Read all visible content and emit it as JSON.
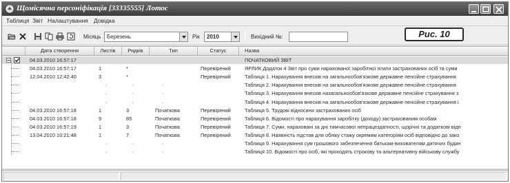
{
  "window": {
    "title": "Щомісячна персоніфікація [33335555] Лотос"
  },
  "menu": [
    "Таблиця",
    "Звіт",
    "Налаштування",
    "Довідка"
  ],
  "toolbar": {
    "month_label": "Місяць",
    "month_value": "Березень",
    "year_label": "Рік",
    "year_value": "2010",
    "outgoing_label": "Вихідний №:",
    "outgoing_value": ""
  },
  "figure_label": "Рис. 10",
  "columns": [
    "Дата створення",
    "Листів",
    "Рядків",
    "Тип",
    "Статус",
    "Назва"
  ],
  "rows": [
    {
      "date": "04.03.2010 16:57:17",
      "sheets": "",
      "lines": "",
      "type": "",
      "status": "",
      "name": "ПОЧАТКОВИЙ ЗВІТ",
      "checked": true,
      "root": true
    },
    {
      "date": "04.03.2010 16:57:17",
      "sheets": "1",
      "lines": "*",
      "type": "",
      "status": "Перевірений",
      "name": "ЯРЛИК Додаток 4 Звіт про суми нарахованої заробітної плати застрахованих осіб та суми"
    },
    {
      "date": "12.04.2010 12:42:40",
      "sheets": "3",
      "lines": "*",
      "type": "",
      "status": "Перевірений",
      "name": "Таблиця 1. Нарахування внесків на загальнообов'язкове державне пенсійне страхування"
    },
    {
      "date": "",
      "sheets": "",
      "lines": "",
      "type": "",
      "status": "",
      "name": "Таблиця 2. Нарахування внесків на загальнообов'язкове державне пенсійне страхування"
    },
    {
      "date": "",
      "sheets": "",
      "lines": "",
      "type": "",
      "status": "",
      "name": "Таблиця 3. Нарахування внесків назагальнообов'язкове державне пенсійне страхування з"
    },
    {
      "date": "",
      "sheets": "",
      "lines": "",
      "type": "",
      "status": "",
      "name": "Таблиця 4. Нарахування внесків на загальнообов'язкове державне пенсійне страхування і"
    },
    {
      "date": "04.03.2010 16:57:18",
      "sheets": "1",
      "lines": "3",
      "type": "Початкова",
      "status": "Перевірений",
      "name": "Таблиця 5. Трудові відносини застрахованих осіб"
    },
    {
      "date": "04.03.2010 16:57:18",
      "sheets": "9",
      "lines": "85",
      "type": "Початкова",
      "status": "Перевірений",
      "name": "Таблиця 6. Відомості про нарахування заробітку (доходу) застрахованим особам"
    },
    {
      "date": "04.03.2010 16:57:19",
      "sheets": "1",
      "lines": "3",
      "type": "Початкова",
      "status": "Перевірений",
      "name": "Таблиця 7. Суми, нараховані за дні тимчасової непрацездатності, щорічні та додаткові відп"
    },
    {
      "date": "13.04.2010 10:21:48",
      "sheets": "1",
      "lines": "7",
      "type": "Початкова",
      "status": "Перевірений",
      "name": "Таблиця 8. Наявність підстав для обліку стажу окремим категоріям осіб відповідно до зако"
    },
    {
      "date": "",
      "sheets": "",
      "lines": "",
      "type": "",
      "status": "",
      "name": "Таблиця 9. Нарахування сум грошового забезпечення батькам-вихователям дитячих будин"
    },
    {
      "date": "",
      "sheets": "",
      "lines": "",
      "type": "",
      "status": "",
      "name": "Таблиця 10. Відомості про осіб, які проходять строкову та альтернативну військову службу"
    }
  ]
}
